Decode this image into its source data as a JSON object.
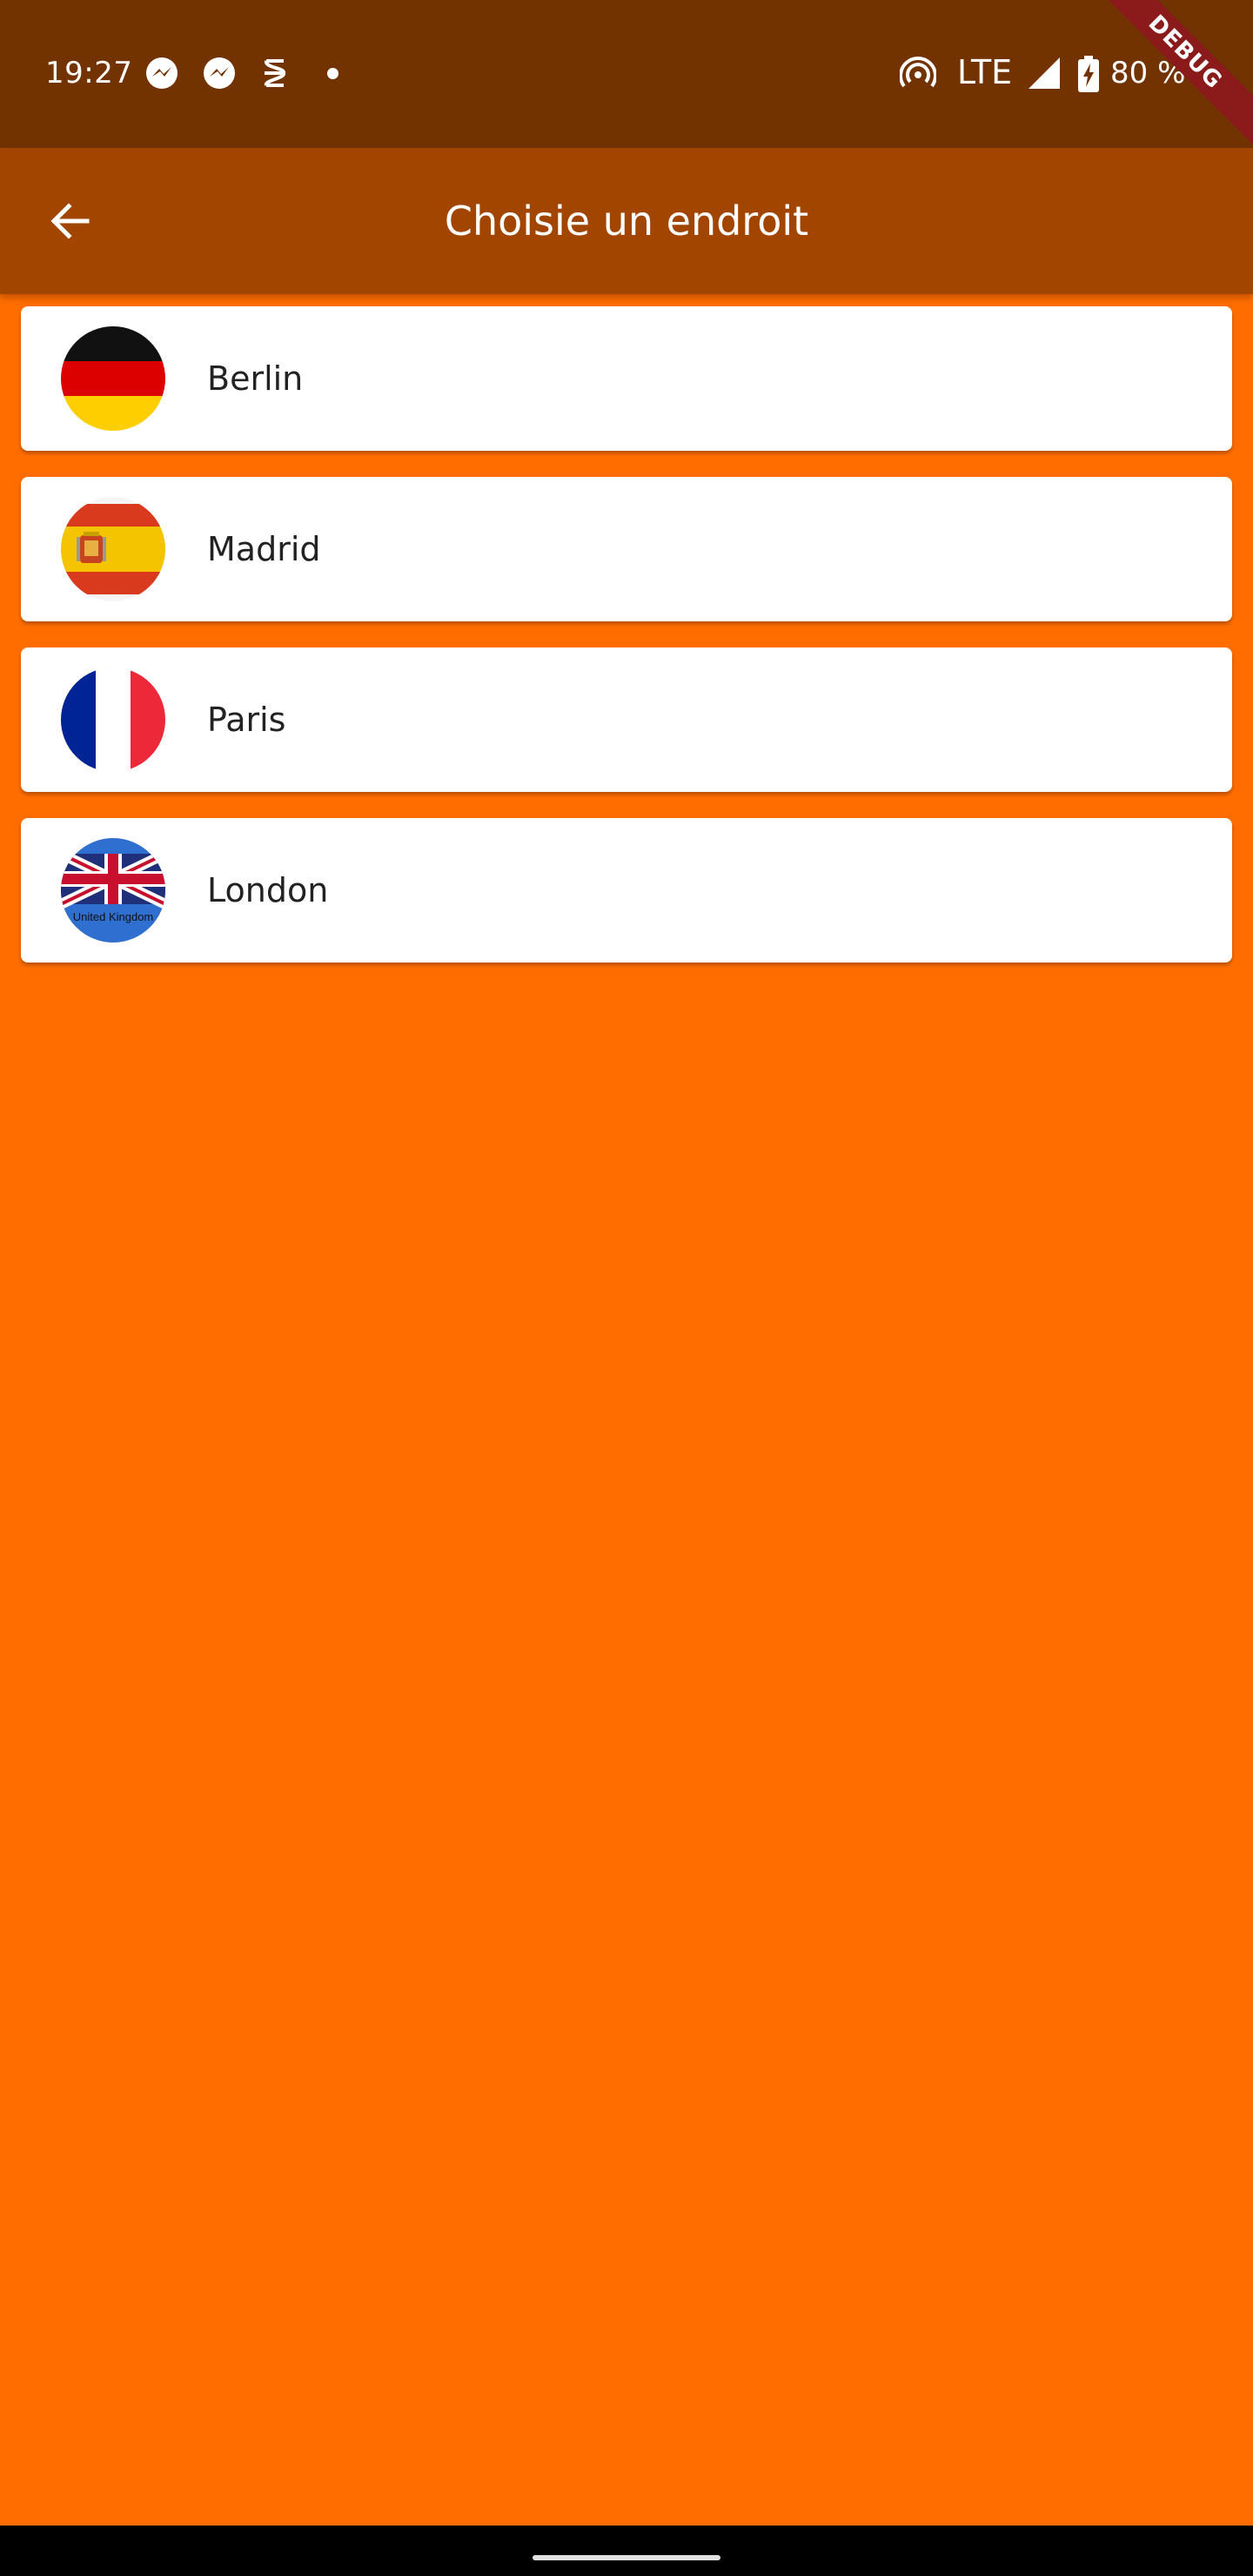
{
  "status_bar": {
    "time": "19:27",
    "network": "LTE",
    "battery": "80 %",
    "icons": [
      "messenger-icon",
      "messenger-icon",
      "notification-app-icon",
      "dot-icon",
      "hotspot-icon",
      "signal-icon",
      "battery-charging-icon"
    ]
  },
  "debug_banner": "DEBUG",
  "app_bar": {
    "title": "Choisie un endroit",
    "back_icon": "arrow-back-icon"
  },
  "cities": [
    {
      "name": "Berlin",
      "flag": "germany-flag-icon"
    },
    {
      "name": "Madrid",
      "flag": "spain-flag-icon"
    },
    {
      "name": "Paris",
      "flag": "france-flag-icon"
    },
    {
      "name": "London",
      "flag": "uk-flag-icon",
      "flag_text": "United Kingdom"
    }
  ],
  "colors": {
    "background": "#FF6D00",
    "app_bar": "#A14500",
    "status_bar": "#733300",
    "card": "#FFFFFF"
  }
}
